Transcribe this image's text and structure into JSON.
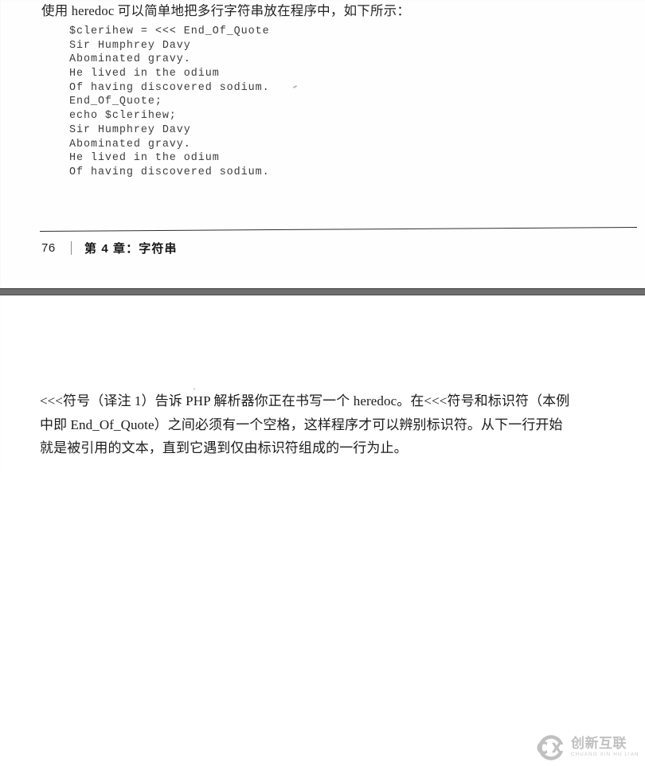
{
  "page": {
    "heading": "使用 heredoc 可以简单地把多行字符串放在程序中，如下所示：",
    "code_lines": [
      "$clerihew = <<< End_Of_Quote",
      "Sir Humphrey Davy",
      "Abominated gravy.",
      "He lived in the odium",
      "Of having discovered sodium.",
      "End_Of_Quote;",
      "echo $clerihew;",
      "Sir Humphrey Davy",
      "Abominated gravy.",
      "He lived in the odium",
      "Of having discovered sodium."
    ],
    "footer": {
      "page_number": "76",
      "chapter_title": "第 4 章：字符串"
    }
  },
  "note": {
    "lines": [
      "<<<符号（译注 1）告诉 PHP 解析器你正在书写一个 heredoc。在<<<符号和标识符（本例",
      "中即 End_Of_Quote）之间必须有一个空格，这样程序才可以辨别标识符。从下一行开始",
      "就是被引用的文本，直到它遇到仅由标识符组成的一行为止。"
    ]
  },
  "watermark": {
    "chinese": "创新互联",
    "pinyin": "CHUANG XIN HU LIAN",
    "logo_letters": "CX"
  },
  "colors": {
    "text": "#1b1b1b",
    "code_text": "#3d3d3d",
    "separator_band": "#6e6e6e",
    "watermark": "#9a9a9a"
  }
}
